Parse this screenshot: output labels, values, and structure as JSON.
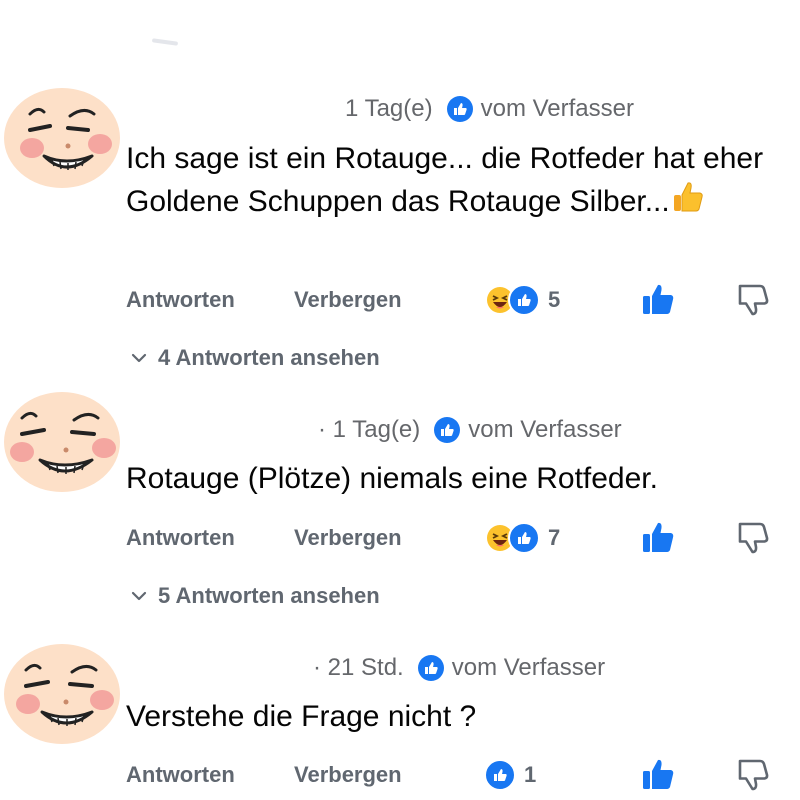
{
  "comments": [
    {
      "time": "1 Tag(e)",
      "author_label": "vom Verfasser",
      "text": "Ich sage ist ein Rotauge... die Rotfeder hat eher Goldene Schuppen das Rotauge Silber...",
      "text_emoji": "thumbs-up-emoji",
      "reply_label": "Antworten",
      "hide_label": "Verbergen",
      "reactions": [
        "haha",
        "like"
      ],
      "reaction_count": "5",
      "view_replies": "4 Antworten ansehen"
    },
    {
      "time": "· 1 Tag(e)",
      "author_label": "vom Verfasser",
      "text": "Rotauge (Plötze) niemals eine Rotfeder.",
      "reply_label": "Antworten",
      "hide_label": "Verbergen",
      "reactions": [
        "haha",
        "like"
      ],
      "reaction_count": "7",
      "view_replies": "5 Antworten ansehen"
    },
    {
      "time": "· 21 Std.",
      "author_label": "vom Verfasser",
      "text": "Verstehe die Frage nicht  ?",
      "reply_label": "Antworten",
      "hide_label": "Verbergen",
      "reactions": [
        "like"
      ],
      "reaction_count": "1"
    }
  ],
  "icons": {
    "avatar": "smirking-face-avatar",
    "author_badge": "thumbs-up-badge-icon",
    "like": "thumbs-up-icon",
    "dislike": "thumbs-down-icon",
    "expand": "chevron-down-icon",
    "reaction_haha": "laughing-face-icon",
    "reaction_like": "like-reaction-icon"
  },
  "colors": {
    "accent": "#1877f2",
    "meta_text": "#65676b",
    "action_text": "#606770",
    "body_text": "#050505",
    "avatar_skin": "#fde0c8",
    "avatar_cheek": "#f4a6a0"
  }
}
